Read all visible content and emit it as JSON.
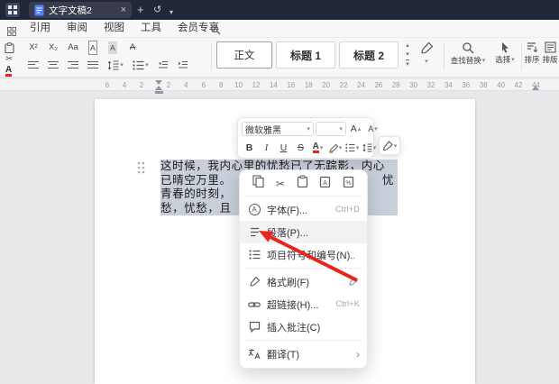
{
  "icons": {
    "caret_down": "▾",
    "caret_up": "▴",
    "close": "×",
    "plus": "+",
    "undo": "↺",
    "chevron_right": "›",
    "scissors": "✂",
    "superscript": "X²",
    "subscript": "X₂",
    "change_case": "Aa",
    "letter_a": "A",
    "bold": "B",
    "italic": "I",
    "underline": "U",
    "strikethrough": "S"
  },
  "colors": {
    "titlebar": "#222639",
    "selection": "#c9cfd9",
    "arrow": "#e8251f",
    "accent_red": "#e8251f"
  },
  "titlebar": {
    "doc_title": "文字文稿2"
  },
  "menubar": {
    "tabs": [
      "引用",
      "审阅",
      "视图",
      "工具",
      "会员专享"
    ]
  },
  "ribbon": {
    "styles": [
      {
        "label": "正文"
      },
      {
        "label": "标题 1"
      },
      {
        "label": "标题 2"
      }
    ],
    "find_replace": "查找替换",
    "select": "选择",
    "sort": "排序",
    "layout": "排版"
  },
  "ruler": {
    "numbers": [
      "6",
      "4",
      "2",
      "2",
      "4",
      "6",
      "8",
      "10",
      "12",
      "14",
      "16",
      "18",
      "20",
      "22",
      "24",
      "26",
      "28",
      "30",
      "32",
      "34",
      "36",
      "38",
      "40",
      "42",
      "44"
    ]
  },
  "document": {
    "lines": [
      {
        "left": "这时候，我内心里的忧愁已了无踪影，内心",
        "right": ""
      },
      {
        "left": "已晴空万里。",
        "right": "忧"
      },
      {
        "left": "青春的时刻，",
        "right": ""
      },
      {
        "left": "愁，忧愁，且",
        "right": ""
      }
    ]
  },
  "mini_toolbar": {
    "font_name": "微软雅黑",
    "font_size": ""
  },
  "context_menu": {
    "items": [
      {
        "label": "字体(F)...",
        "shortcut": "Ctrl+D"
      },
      {
        "label": "段落(P)...",
        "shortcut": ""
      },
      {
        "label": "项目符号和编号(N)...",
        "shortcut": ""
      },
      {
        "label": "格式刷(F)",
        "shortcut": ""
      },
      {
        "label": "超链接(H)...",
        "shortcut": "Ctrl+K"
      },
      {
        "label": "插入批注(C)",
        "shortcut": ""
      },
      {
        "label": "翻译(T)",
        "shortcut": ""
      }
    ]
  }
}
